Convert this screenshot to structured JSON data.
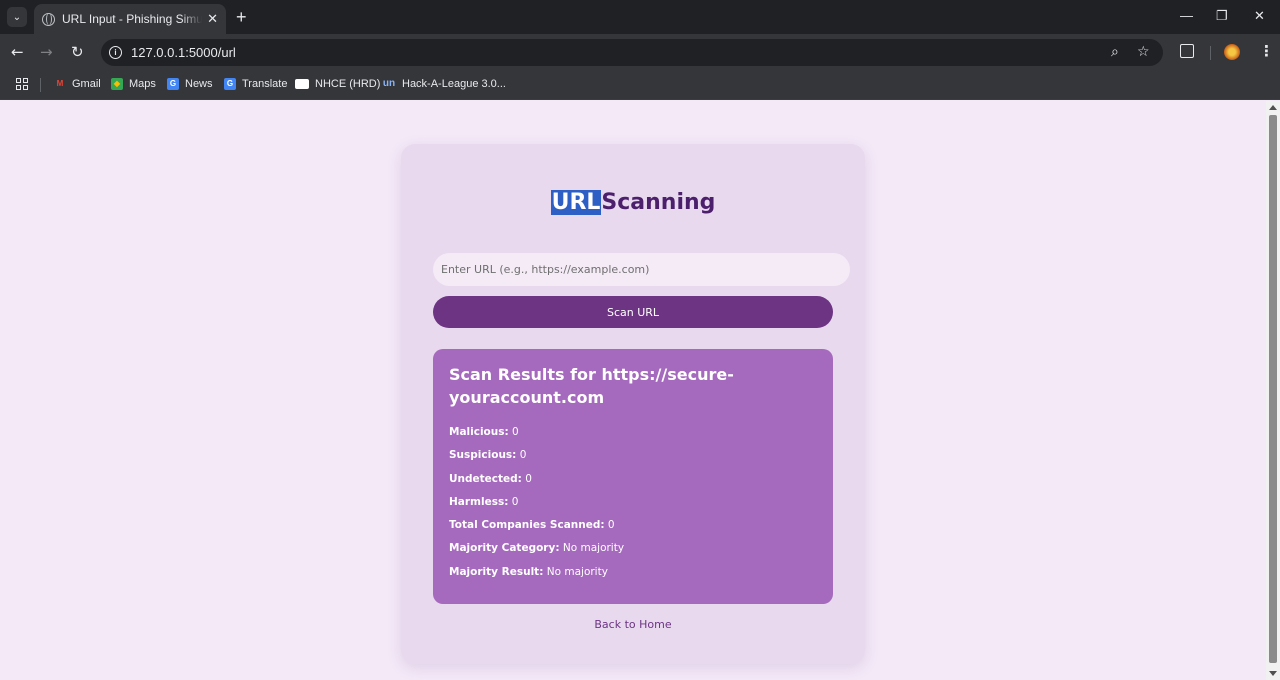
{
  "browser": {
    "tab_title": "URL Input - Phishing Simulation",
    "url": "127.0.0.1:5000/url",
    "bookmarks": [
      {
        "label": "Gmail",
        "icon": "gmail-icon",
        "color": "#ea4335"
      },
      {
        "label": "Maps",
        "icon": "maps-icon",
        "color": "#34a853"
      },
      {
        "label": "News",
        "icon": "news-icon",
        "color": "#4285f4"
      },
      {
        "label": "Translate",
        "icon": "translate-icon",
        "color": "#4285f4"
      },
      {
        "label": "NHCE (HRD)",
        "icon": "nhce-icon",
        "color": "#ffffff"
      },
      {
        "label": "Hack-A-League 3.0...",
        "icon": "unstop-icon",
        "color": "#1c4ed8"
      }
    ]
  },
  "page": {
    "heading_highlight": "URL",
    "heading_rest": "Scanning",
    "url_placeholder": "Enter URL (e.g., https://example.com)",
    "scan_button": "Scan URL",
    "results": {
      "title": "Scan Results for https://secure-youraccount.com",
      "lines": [
        {
          "label": "Malicious:",
          "value": "0"
        },
        {
          "label": "Suspicious:",
          "value": "0"
        },
        {
          "label": "Undetected:",
          "value": "0"
        },
        {
          "label": "Harmless:",
          "value": "0"
        },
        {
          "label": "Total Companies Scanned:",
          "value": "0"
        },
        {
          "label": "Majority Category:",
          "value": "No majority"
        },
        {
          "label": "Majority Result:",
          "value": "No majority"
        }
      ]
    },
    "back_link": "Back to Home"
  },
  "colors": {
    "page_bg": "#f3e9f7",
    "card_bg": "#e9d9ef",
    "primary": "#6c3483",
    "results_bg": "#a569bd",
    "highlight": "#2d5fc4"
  }
}
